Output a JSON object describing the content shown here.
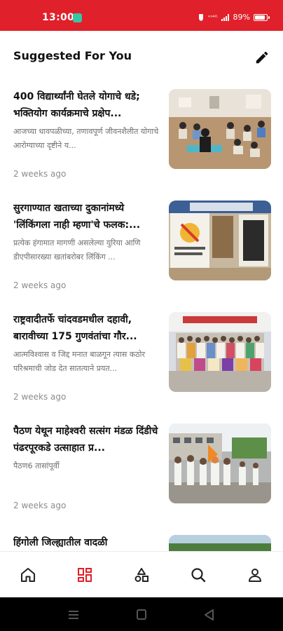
{
  "status_bar": {
    "time": "13:00",
    "network": "ᵛᵒ⁴ᴳ",
    "battery_text": "89%",
    "battery_level": 0.89,
    "bg_color": "#e0202a"
  },
  "header": {
    "title": "Suggested For You",
    "edit_icon": "pencil-icon"
  },
  "articles": [
    {
      "title": "400 विद्यार्थ्यांनी घेतले योगाचे धडे; भक्तियोग कार्यक्रमाचे प्रक्षेप...",
      "snippet": "आजच्या धावपळीच्या, तणावपूर्ण जीवनशैलीत योगाचे आरोग्याच्या दृष्टीने य...",
      "time": "2 weeks ago"
    },
    {
      "title": "सुरगाण्यात खताच्या दुकानांमध्ये 'लिंकिंगला नाही म्हणा'चे फलक:...",
      "snippet": "प्रत्येक हंगामात मागणी असलेल्या युरिया आणि डीएपीसारख्या खतांबरोबर लिंकिंग ...",
      "time": "2 weeks ago"
    },
    {
      "title": "राष्ट्रवादीतर्फे चांदवडमधील दहावी, बारावीच्या 175 गुणवंतांचा गौर...",
      "snippet": "आत्मविश्वास व जिद्द मनात बाळगून त्यास कठोर परिश्रमाची जोड देत सातत्याने प्रयत...",
      "time": "2 weeks ago"
    },
    {
      "title": "पैठण येथून माहेश्वरी सत्संग मंडळ दिंडीचे पंढरपूरकडे उत्साहात प्र...",
      "snippet": "पैठण6 तासांपूर्वी",
      "time": "2 weeks ago"
    },
    {
      "title": "हिंगोली जिल्ह्यातील वादळी",
      "snippet": "",
      "time": ""
    }
  ],
  "bottom_nav": {
    "items": [
      {
        "name": "home",
        "icon": "home-icon",
        "active": false
      },
      {
        "name": "feed",
        "icon": "grid-icon",
        "active": true
      },
      {
        "name": "categories",
        "icon": "shapes-icon",
        "active": false
      },
      {
        "name": "search",
        "icon": "search-icon",
        "active": false
      },
      {
        "name": "profile",
        "icon": "user-icon",
        "active": false
      }
    ],
    "active_color": "#e0202a",
    "inactive_color": "#222222"
  }
}
